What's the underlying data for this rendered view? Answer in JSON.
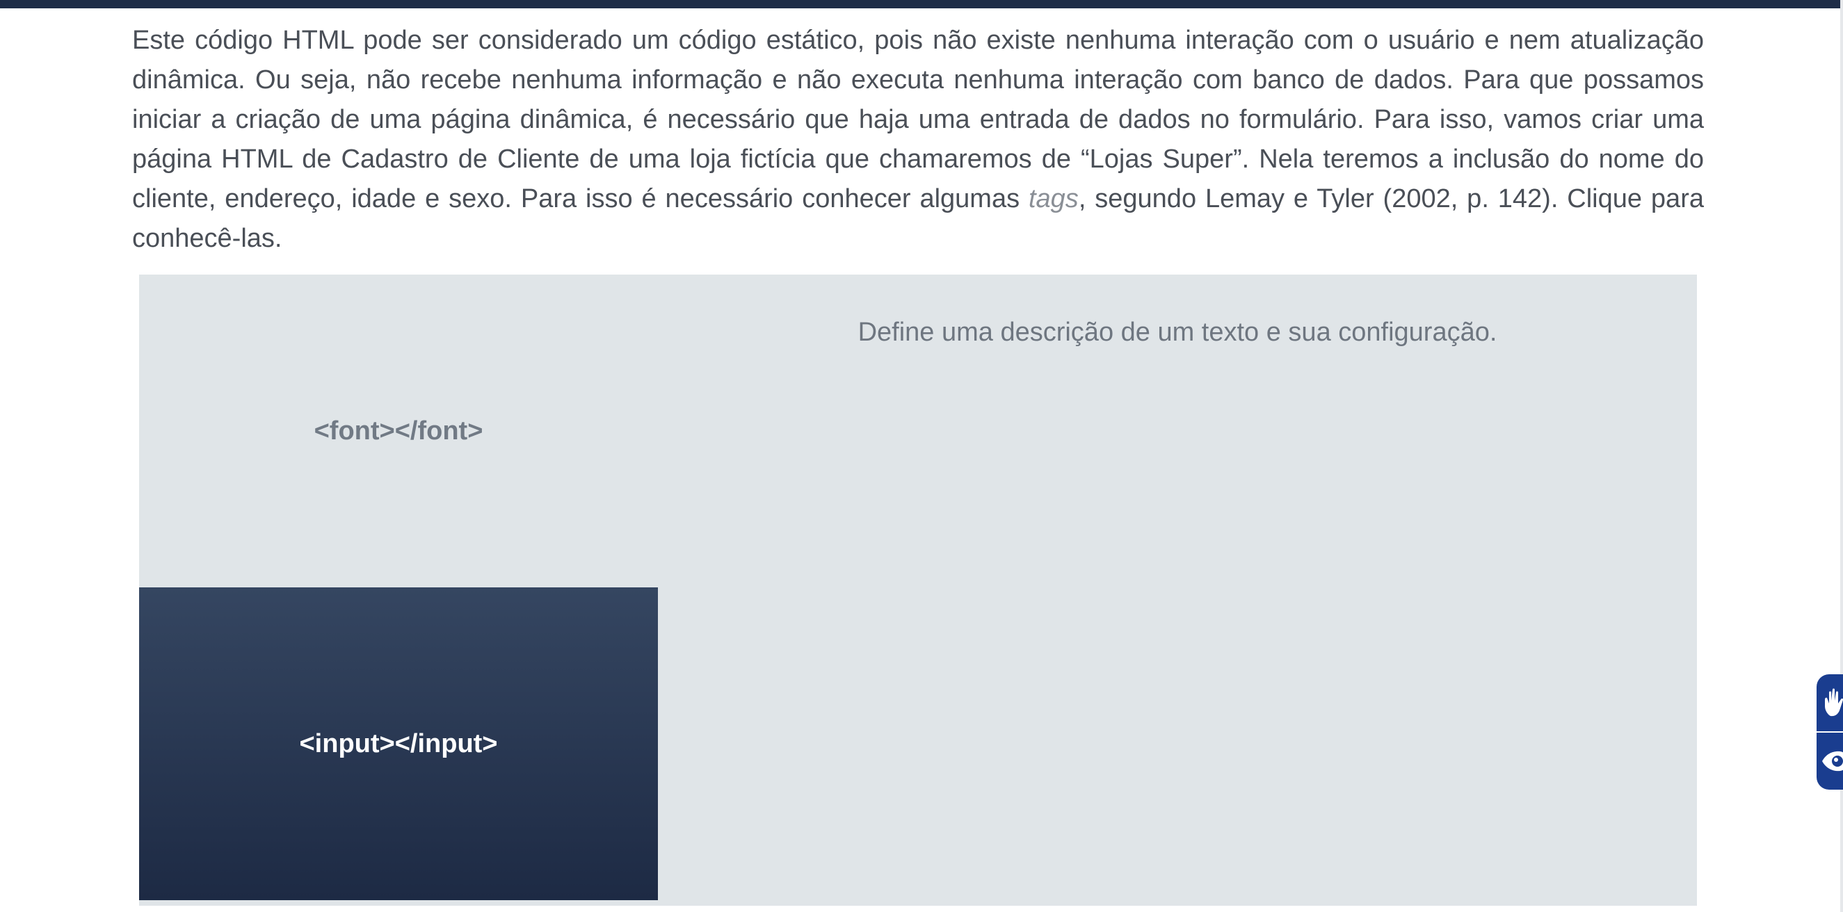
{
  "paragraph": {
    "before_italic": "Este código HTML pode ser considerado um código estático, pois não existe nenhuma interação com o usuário e nem atualização dinâmica. Ou seja, não recebe nenhuma informação e não executa nenhuma interação com banco de dados. Para que possamos iniciar a criação de uma página dinâmica, é necessário que haja uma entrada de dados no formulário. Para isso, vamos criar uma página HTML de Cadastro de Cliente de uma loja fictícia que chamaremos de “Lojas Super”. Nela teremos a inclusão do nome do cliente, endereço, idade e sexo. Para isso é necessário conhecer algumas ",
    "italic": "tags",
    "after_italic": ", segundo Lemay e Tyler (2002, p. 142). Clique para conhecê-las."
  },
  "tabs": [
    {
      "label": "<font></font>",
      "active": true
    },
    {
      "label": "<input></input>",
      "active": false
    }
  ],
  "content": {
    "text": "Define uma descrição de um texto e sua configuração."
  },
  "accessibility": {
    "icons": [
      "hand-sign-language-icon",
      "eye-icon"
    ]
  },
  "colors": {
    "top_bar": "#1f2d47",
    "panel_bg": "#e0e5e8",
    "dark_tab_top": "#354661",
    "dark_tab_bottom": "#1d2a44",
    "widget": "#1a3d8f"
  }
}
